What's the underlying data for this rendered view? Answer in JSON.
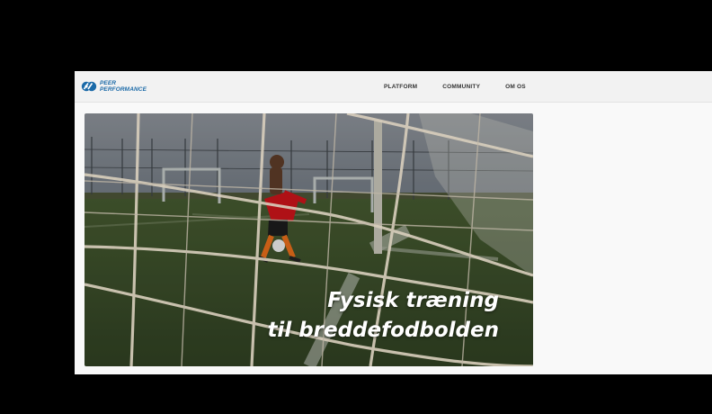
{
  "brand": {
    "line1": "PEER",
    "line2": "PERFORMANCE",
    "color": "#1b6aa8"
  },
  "nav": {
    "items": [
      "PLATFORM",
      "COMMUNITY",
      "OM OS"
    ]
  },
  "hero": {
    "line1": "Fysisk træning",
    "line2": "til breddefodbolden"
  }
}
